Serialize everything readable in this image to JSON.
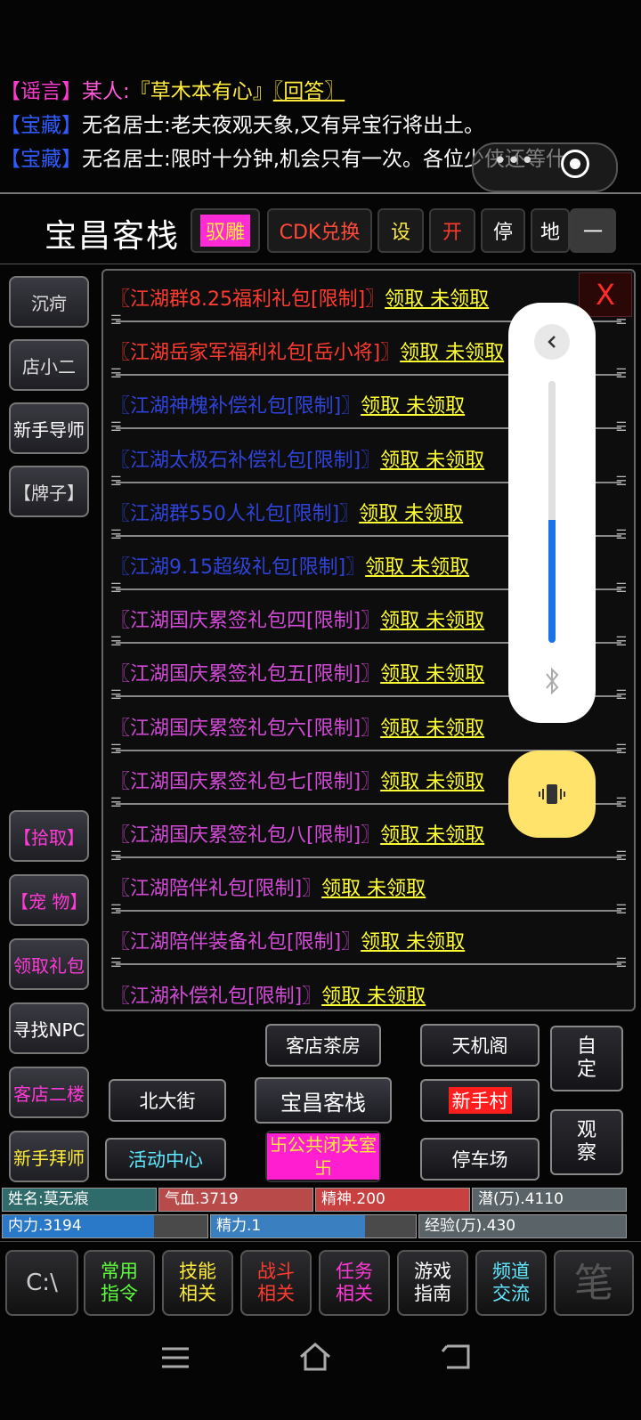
{
  "chat": [
    {
      "tag": "【谣言】",
      "speaker": "某人:",
      "msg": "『草木本有心』",
      "link": "〖回答〗"
    },
    {
      "tag": "【宝藏】",
      "speaker": "",
      "msg": "无名居士:老夫夜观天象,又有异宝行将出土。"
    },
    {
      "tag": "【宝藏】",
      "speaker": "",
      "msg": "无名居士:限时十分钟,机会只有一次。各位少侠还等什"
    }
  ],
  "header": {
    "title": "宝昌客栈",
    "buttons": {
      "b1": "驭雕",
      "b2": "CDK兑换",
      "b3": "设",
      "b4": "开",
      "b5": "停",
      "b6": "地",
      "b7": "一"
    }
  },
  "left_buttons": {
    "top": [
      "沉疴",
      "店小二",
      "新手导师",
      "【牌子】"
    ],
    "bottom": [
      "【拾取】",
      "【宠 物】",
      "领取礼包",
      "寻找NPC",
      "客店二楼",
      "新手拜师"
    ]
  },
  "gifts": [
    {
      "name": "〖江湖群8.25福利礼包[限制]〗",
      "action": "领取 未领取",
      "color": "red"
    },
    {
      "name": "〖江湖岳家军福利礼包[岳小将]〗",
      "action": "领取 未领取",
      "color": "red"
    },
    {
      "name": "〖江湖神槐补偿礼包[限制]〗",
      "action": "领取 未领取",
      "color": "blue"
    },
    {
      "name": "〖江湖太极石补偿礼包[限制]〗",
      "action": "领取 未领取",
      "color": "blue"
    },
    {
      "name": "〖江湖群550人礼包[限制]〗",
      "action": "领取 未领取",
      "color": "blue"
    },
    {
      "name": "〖江湖9.15超级礼包[限制]〗",
      "action": "领取 未领取",
      "color": "blue"
    },
    {
      "name": "〖江湖国庆累签礼包四[限制]〗",
      "action": "领取 未领取",
      "color": "mag"
    },
    {
      "name": "〖江湖国庆累签礼包五[限制]〗",
      "action": "领取 未领取",
      "color": "mag"
    },
    {
      "name": "〖江湖国庆累签礼包六[限制]〗",
      "action": "领取 未领取",
      "color": "mag"
    },
    {
      "name": "〖江湖国庆累签礼包七[限制]〗",
      "action": "领取 未领取",
      "color": "mag"
    },
    {
      "name": "〖江湖国庆累签礼包八[限制]〗",
      "action": "领取 未领取",
      "color": "mag"
    },
    {
      "name": "〖江湖陪伴礼包[限制]〗",
      "action": "领取 未领取",
      "color": "mag"
    },
    {
      "name": "〖江湖陪伴装备礼包[限制]〗",
      "action": "领取 未领取",
      "color": "mag"
    },
    {
      "name": "〖江湖补偿礼包[限制]〗",
      "action": "领取 未领取",
      "color": "mag"
    }
  ],
  "panel_close": "X",
  "nav": {
    "teahouse": "客店茶房",
    "tianji": "天机阁",
    "custom": "自定",
    "north": "北大街",
    "current": "宝昌客栈",
    "newbie": "新手村",
    "observe": "观察",
    "activity": "活动中心",
    "retreat": "卐公共闭关室卐",
    "parking": "停车场"
  },
  "stats": {
    "name": "姓名:莫无痕",
    "hp": "气血.3719",
    "spirit": "精神.200",
    "potential": "潜(万).4110",
    "neili": "内力.3194",
    "jingli": "精力.1",
    "exp": "经验(万).430",
    "neili_fill": 0.74,
    "jingli_fill": 0.75
  },
  "tabs": [
    "C:\\",
    "常用指令",
    "技能相关",
    "战斗相关",
    "任务相关",
    "游戏指南",
    "频道交流",
    "笔"
  ],
  "colors": {
    "red": "#ff3b30",
    "blue": "#2f43d9",
    "magenta": "#d14ad6",
    "yellow": "#ffff33",
    "volume": "#1a73e8"
  }
}
